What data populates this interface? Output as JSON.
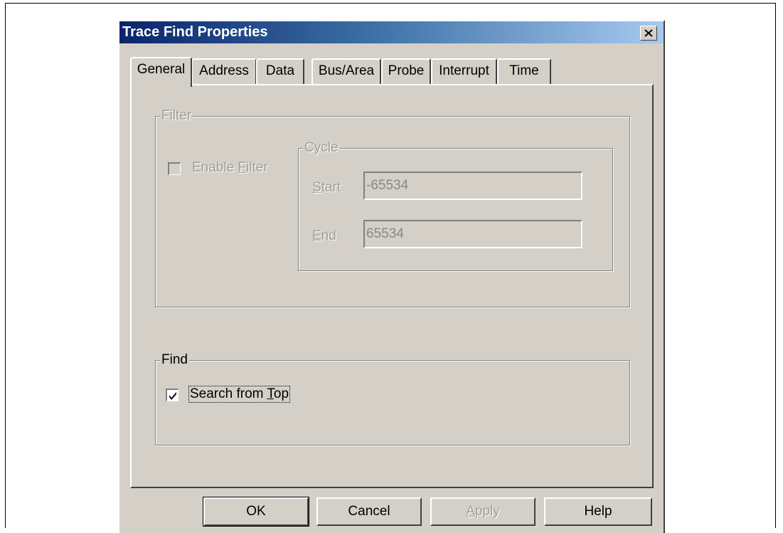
{
  "dialog": {
    "title": "Trace Find Properties",
    "close_glyph": "✕"
  },
  "tabs": [
    {
      "label": "General",
      "active": true
    },
    {
      "label": "Address",
      "active": false
    },
    {
      "label": "Data",
      "active": false
    },
    {
      "label": "Bus/Area",
      "active": false
    },
    {
      "label": "Probe",
      "active": false
    },
    {
      "label": "Interrupt",
      "active": false
    },
    {
      "label": "Time",
      "active": false
    }
  ],
  "filter": {
    "group_label": "Filter",
    "enable_label_pre": "Enable ",
    "enable_label_key": "F",
    "enable_label_post": "ilter",
    "enable_checked": false,
    "enabled": false,
    "cycle": {
      "group_label": "Cycle",
      "start_label_key": "S",
      "start_label_post": "tart",
      "start_value": "-65534",
      "end_label_key": "E",
      "end_label_post": "nd",
      "end_value": "65534"
    }
  },
  "find": {
    "group_label": "Find",
    "search_label_pre": "Search from ",
    "search_label_key": "T",
    "search_label_post": "op",
    "search_checked": true
  },
  "buttons": {
    "ok": "OK",
    "cancel": "Cancel",
    "apply_key": "A",
    "apply_post": "pply",
    "help": "Help"
  },
  "colors": {
    "face": "#d4d0c8",
    "title_start": "#0a246a",
    "title_end": "#a6caf0",
    "disabled_text": "#a09e98"
  },
  "icons": {
    "close": "close-icon",
    "check": "checkmark-icon"
  }
}
